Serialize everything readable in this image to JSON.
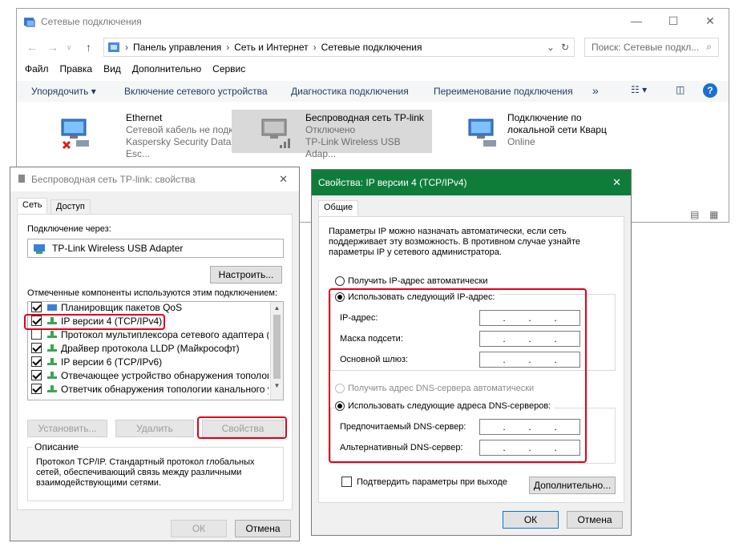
{
  "explorer": {
    "title": "Сетевые подключения",
    "breadcrumb": [
      "Панель управления",
      "Сеть и Интернет",
      "Сетевые подключения"
    ],
    "search_placeholder": "Поиск: Сетевые подкл...",
    "menu": [
      "Файл",
      "Правка",
      "Вид",
      "Дополнительно",
      "Сервис"
    ],
    "toolbar": [
      "Упорядочить ▾",
      "Включение сетевого устройства",
      "Диагностика подключения",
      "Переименование подключения",
      "»"
    ],
    "connections": [
      {
        "name": "Ethernet",
        "status": "Сетевой кабель не подкл...",
        "device": "Kaspersky Security Data Esc..."
      },
      {
        "name": "Беспроводная сеть TP-link",
        "status": "Отключено",
        "device": "TP-Link Wireless USB Adap..."
      },
      {
        "name": "Подключение по",
        "name2": "локальной сети Кварц",
        "status": "Online"
      }
    ]
  },
  "props": {
    "title": "Беспроводная сеть TP-link: свойства",
    "tabs": [
      "Сеть",
      "Доступ"
    ],
    "connect_via_label": "Подключение через:",
    "adapter": "TP-Link Wireless USB Adapter",
    "configure": "Настроить...",
    "components_label": "Отмеченные компоненты используются этим подключением:",
    "components": [
      "Планировщик пакетов QoS",
      "IP версии 4 (TCP/IPv4)",
      "Протокол мультиплексора сетевого адаптера (Май",
      "Драйвер протокола LLDP (Майкрософт)",
      "IP версии 6 (TCP/IPv6)",
      "Отвечающее устройство обнаружения топологии к",
      "Ответчик обнаружения топологии канального уров"
    ],
    "install": "Установить...",
    "remove": "Удалить",
    "properties": "Свойства",
    "description_label": "Описание",
    "description": "Протокол TCP/IP. Стандартный протокол глобальных сетей, обеспечивающий связь между различными взаимодействующими сетями.",
    "ok": "ОК",
    "cancel": "Отмена"
  },
  "ipv4": {
    "title": "Свойства: IP версии 4 (TCP/IPv4)",
    "tab": "Общие",
    "intro": "Параметры IP можно назначать автоматически, если сеть поддерживает эту возможность. В противном случае узнайте параметры IP у сетевого администратора.",
    "auto_ip": "Получить IP-адрес автоматически",
    "manual_ip": "Использовать следующий IP-адрес:",
    "ip_label": "IP-адрес:",
    "mask_label": "Маска подсети:",
    "gateway_label": "Основной шлюз:",
    "auto_dns": "Получить адрес DNS-сервера автоматически",
    "manual_dns": "Использовать следующие адреса DNS-серверов:",
    "pref_dns": "Предпочитаемый DNS-сервер:",
    "alt_dns": "Альтернативный DNS-сервер:",
    "validate": "Подтвердить параметры при выходе",
    "advanced": "Дополнительно...",
    "ok": "ОК",
    "cancel": "Отмена"
  },
  "colors": {
    "highlight": "#e0001a",
    "titlebar_green": "#0f7d3a"
  }
}
